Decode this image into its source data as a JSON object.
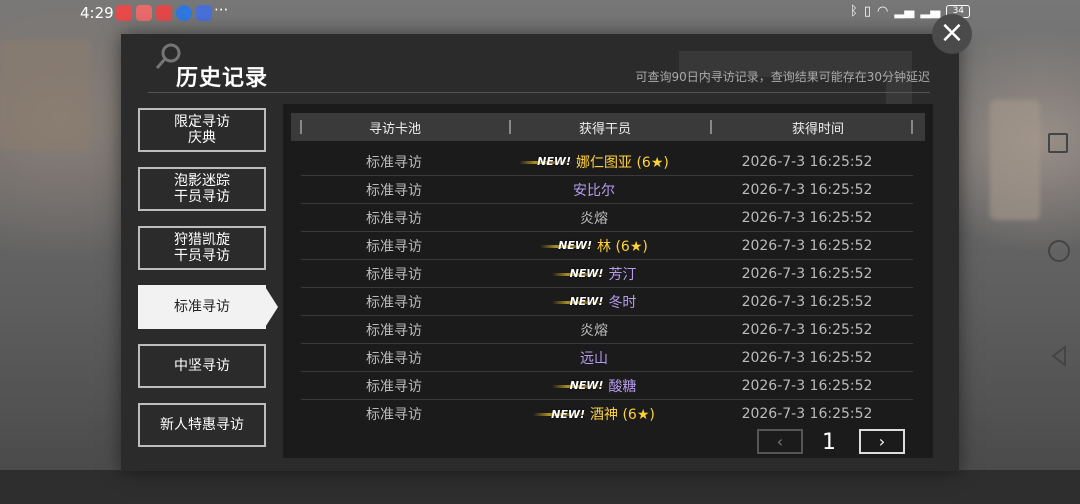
{
  "status_bar": {
    "time": "4:29",
    "more": "···",
    "battery": "34"
  },
  "dialog": {
    "title": "历史记录",
    "subtitle": "可查询90日内寻访记录，查询结果可能存在30分钟延迟",
    "close": "×"
  },
  "tabs": [
    {
      "line1": "限定寻访",
      "line2": "庆典",
      "active": false
    },
    {
      "line1": "泡影迷踪",
      "line2": "干员寻访",
      "active": false
    },
    {
      "line1": "狩猎凯旋",
      "line2": "干员寻访",
      "active": false
    },
    {
      "line1": "标准寻访",
      "line2": "",
      "active": true
    },
    {
      "line1": "中坚寻访",
      "line2": "",
      "active": false
    },
    {
      "line1": "新人特惠寻访",
      "line2": "",
      "active": false
    }
  ],
  "table": {
    "headers": [
      "寻访卡池",
      "获得干员",
      "获得时间"
    ],
    "new_label": "NEW!",
    "rows": [
      {
        "pool": "标准寻访",
        "new": true,
        "operator": "娜仁图亚 (6★)",
        "rarity": "r6",
        "time": "2026-7-3 16:25:52"
      },
      {
        "pool": "标准寻访",
        "new": false,
        "operator": "安比尔",
        "rarity": "r4",
        "time": "2026-7-3 16:25:52"
      },
      {
        "pool": "标准寻访",
        "new": false,
        "operator": "炎熔",
        "rarity": "r3",
        "time": "2026-7-3 16:25:52"
      },
      {
        "pool": "标准寻访",
        "new": true,
        "operator": "林 (6★)",
        "rarity": "r6",
        "time": "2026-7-3 16:25:52"
      },
      {
        "pool": "标准寻访",
        "new": true,
        "operator": "芳汀",
        "rarity": "r4",
        "time": "2026-7-3 16:25:52"
      },
      {
        "pool": "标准寻访",
        "new": true,
        "operator": "冬时",
        "rarity": "r4",
        "time": "2026-7-3 16:25:52"
      },
      {
        "pool": "标准寻访",
        "new": false,
        "operator": "炎熔",
        "rarity": "r3",
        "time": "2026-7-3 16:25:52"
      },
      {
        "pool": "标准寻访",
        "new": false,
        "operator": "远山",
        "rarity": "r4",
        "time": "2026-7-3 16:25:52"
      },
      {
        "pool": "标准寻访",
        "new": true,
        "operator": "酸糖",
        "rarity": "r4",
        "time": "2026-7-3 16:25:52"
      },
      {
        "pool": "标准寻访",
        "new": true,
        "operator": "酒神 (6★)",
        "rarity": "r6",
        "time": "2026-7-3 16:25:52"
      }
    ]
  },
  "pager": {
    "prev": "‹",
    "page": "1",
    "next": "›"
  },
  "colors": {
    "six_star": "#ffd23a",
    "four_star": "#b79cf0",
    "three_star": "#bbbbbb"
  }
}
